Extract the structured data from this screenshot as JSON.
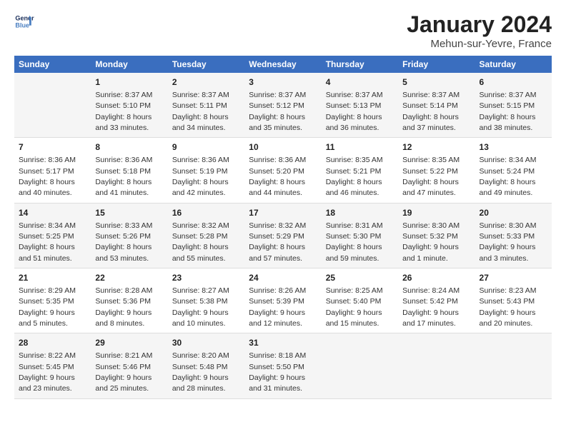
{
  "logo": {
    "line1": "General",
    "line2": "Blue"
  },
  "title": "January 2024",
  "subtitle": "Mehun-sur-Yevre, France",
  "headers": [
    "Sunday",
    "Monday",
    "Tuesday",
    "Wednesday",
    "Thursday",
    "Friday",
    "Saturday"
  ],
  "weeks": [
    [
      {
        "day": "",
        "sunrise": "",
        "sunset": "",
        "daylight": ""
      },
      {
        "day": "1",
        "sunrise": "Sunrise: 8:37 AM",
        "sunset": "Sunset: 5:10 PM",
        "daylight": "Daylight: 8 hours and 33 minutes."
      },
      {
        "day": "2",
        "sunrise": "Sunrise: 8:37 AM",
        "sunset": "Sunset: 5:11 PM",
        "daylight": "Daylight: 8 hours and 34 minutes."
      },
      {
        "day": "3",
        "sunrise": "Sunrise: 8:37 AM",
        "sunset": "Sunset: 5:12 PM",
        "daylight": "Daylight: 8 hours and 35 minutes."
      },
      {
        "day": "4",
        "sunrise": "Sunrise: 8:37 AM",
        "sunset": "Sunset: 5:13 PM",
        "daylight": "Daylight: 8 hours and 36 minutes."
      },
      {
        "day": "5",
        "sunrise": "Sunrise: 8:37 AM",
        "sunset": "Sunset: 5:14 PM",
        "daylight": "Daylight: 8 hours and 37 minutes."
      },
      {
        "day": "6",
        "sunrise": "Sunrise: 8:37 AM",
        "sunset": "Sunset: 5:15 PM",
        "daylight": "Daylight: 8 hours and 38 minutes."
      }
    ],
    [
      {
        "day": "7",
        "sunrise": "Sunrise: 8:36 AM",
        "sunset": "Sunset: 5:17 PM",
        "daylight": "Daylight: 8 hours and 40 minutes."
      },
      {
        "day": "8",
        "sunrise": "Sunrise: 8:36 AM",
        "sunset": "Sunset: 5:18 PM",
        "daylight": "Daylight: 8 hours and 41 minutes."
      },
      {
        "day": "9",
        "sunrise": "Sunrise: 8:36 AM",
        "sunset": "Sunset: 5:19 PM",
        "daylight": "Daylight: 8 hours and 42 minutes."
      },
      {
        "day": "10",
        "sunrise": "Sunrise: 8:36 AM",
        "sunset": "Sunset: 5:20 PM",
        "daylight": "Daylight: 8 hours and 44 minutes."
      },
      {
        "day": "11",
        "sunrise": "Sunrise: 8:35 AM",
        "sunset": "Sunset: 5:21 PM",
        "daylight": "Daylight: 8 hours and 46 minutes."
      },
      {
        "day": "12",
        "sunrise": "Sunrise: 8:35 AM",
        "sunset": "Sunset: 5:22 PM",
        "daylight": "Daylight: 8 hours and 47 minutes."
      },
      {
        "day": "13",
        "sunrise": "Sunrise: 8:34 AM",
        "sunset": "Sunset: 5:24 PM",
        "daylight": "Daylight: 8 hours and 49 minutes."
      }
    ],
    [
      {
        "day": "14",
        "sunrise": "Sunrise: 8:34 AM",
        "sunset": "Sunset: 5:25 PM",
        "daylight": "Daylight: 8 hours and 51 minutes."
      },
      {
        "day": "15",
        "sunrise": "Sunrise: 8:33 AM",
        "sunset": "Sunset: 5:26 PM",
        "daylight": "Daylight: 8 hours and 53 minutes."
      },
      {
        "day": "16",
        "sunrise": "Sunrise: 8:32 AM",
        "sunset": "Sunset: 5:28 PM",
        "daylight": "Daylight: 8 hours and 55 minutes."
      },
      {
        "day": "17",
        "sunrise": "Sunrise: 8:32 AM",
        "sunset": "Sunset: 5:29 PM",
        "daylight": "Daylight: 8 hours and 57 minutes."
      },
      {
        "day": "18",
        "sunrise": "Sunrise: 8:31 AM",
        "sunset": "Sunset: 5:30 PM",
        "daylight": "Daylight: 8 hours and 59 minutes."
      },
      {
        "day": "19",
        "sunrise": "Sunrise: 8:30 AM",
        "sunset": "Sunset: 5:32 PM",
        "daylight": "Daylight: 9 hours and 1 minute."
      },
      {
        "day": "20",
        "sunrise": "Sunrise: 8:30 AM",
        "sunset": "Sunset: 5:33 PM",
        "daylight": "Daylight: 9 hours and 3 minutes."
      }
    ],
    [
      {
        "day": "21",
        "sunrise": "Sunrise: 8:29 AM",
        "sunset": "Sunset: 5:35 PM",
        "daylight": "Daylight: 9 hours and 5 minutes."
      },
      {
        "day": "22",
        "sunrise": "Sunrise: 8:28 AM",
        "sunset": "Sunset: 5:36 PM",
        "daylight": "Daylight: 9 hours and 8 minutes."
      },
      {
        "day": "23",
        "sunrise": "Sunrise: 8:27 AM",
        "sunset": "Sunset: 5:38 PM",
        "daylight": "Daylight: 9 hours and 10 minutes."
      },
      {
        "day": "24",
        "sunrise": "Sunrise: 8:26 AM",
        "sunset": "Sunset: 5:39 PM",
        "daylight": "Daylight: 9 hours and 12 minutes."
      },
      {
        "day": "25",
        "sunrise": "Sunrise: 8:25 AM",
        "sunset": "Sunset: 5:40 PM",
        "daylight": "Daylight: 9 hours and 15 minutes."
      },
      {
        "day": "26",
        "sunrise": "Sunrise: 8:24 AM",
        "sunset": "Sunset: 5:42 PM",
        "daylight": "Daylight: 9 hours and 17 minutes."
      },
      {
        "day": "27",
        "sunrise": "Sunrise: 8:23 AM",
        "sunset": "Sunset: 5:43 PM",
        "daylight": "Daylight: 9 hours and 20 minutes."
      }
    ],
    [
      {
        "day": "28",
        "sunrise": "Sunrise: 8:22 AM",
        "sunset": "Sunset: 5:45 PM",
        "daylight": "Daylight: 9 hours and 23 minutes."
      },
      {
        "day": "29",
        "sunrise": "Sunrise: 8:21 AM",
        "sunset": "Sunset: 5:46 PM",
        "daylight": "Daylight: 9 hours and 25 minutes."
      },
      {
        "day": "30",
        "sunrise": "Sunrise: 8:20 AM",
        "sunset": "Sunset: 5:48 PM",
        "daylight": "Daylight: 9 hours and 28 minutes."
      },
      {
        "day": "31",
        "sunrise": "Sunrise: 8:18 AM",
        "sunset": "Sunset: 5:50 PM",
        "daylight": "Daylight: 9 hours and 31 minutes."
      },
      {
        "day": "",
        "sunrise": "",
        "sunset": "",
        "daylight": ""
      },
      {
        "day": "",
        "sunrise": "",
        "sunset": "",
        "daylight": ""
      },
      {
        "day": "",
        "sunrise": "",
        "sunset": "",
        "daylight": ""
      }
    ]
  ]
}
